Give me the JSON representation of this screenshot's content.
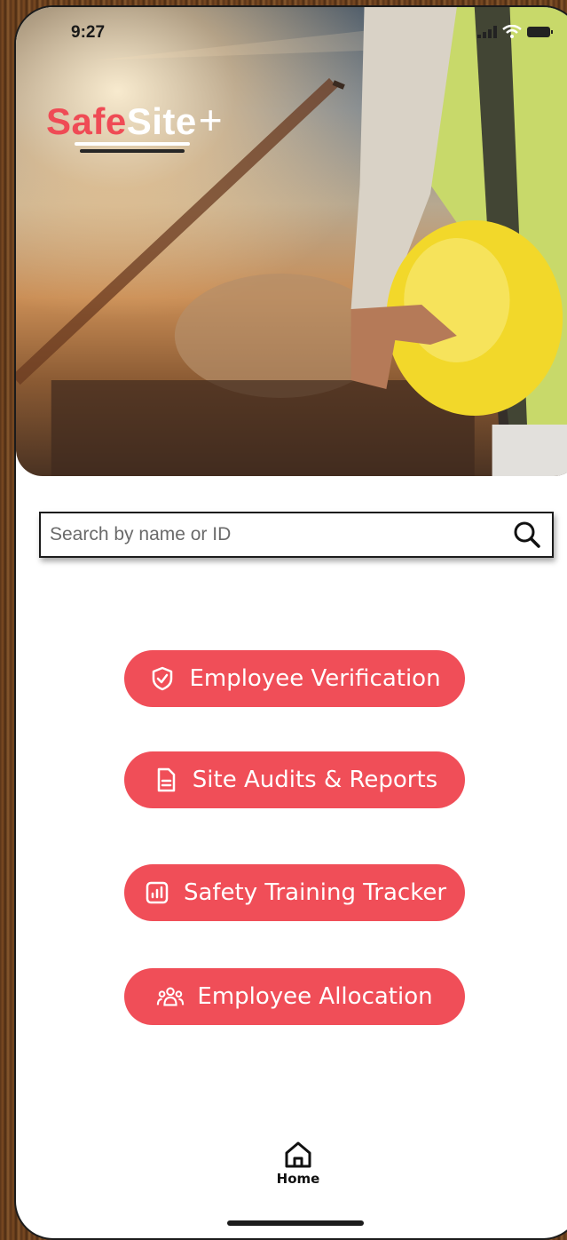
{
  "status_bar": {
    "time": "9:27"
  },
  "brand": {
    "part1": "Safe",
    "part2": "Site",
    "part3": "+"
  },
  "search": {
    "placeholder": "Search by name or ID"
  },
  "actions": [
    {
      "label": "Employee Verification",
      "icon": "shield-check-icon"
    },
    {
      "label": "Site Audits & Reports",
      "icon": "document-icon"
    },
    {
      "label": "Safety Training Tracker",
      "icon": "bar-chart-icon"
    },
    {
      "label": "Employee Allocation",
      "icon": "people-group-icon"
    }
  ],
  "bottom_nav": {
    "home_label": "Home",
    "home_icon": "home-icon"
  },
  "colors": {
    "accent": "#f04e58",
    "logo_red": "#ef4b55"
  }
}
